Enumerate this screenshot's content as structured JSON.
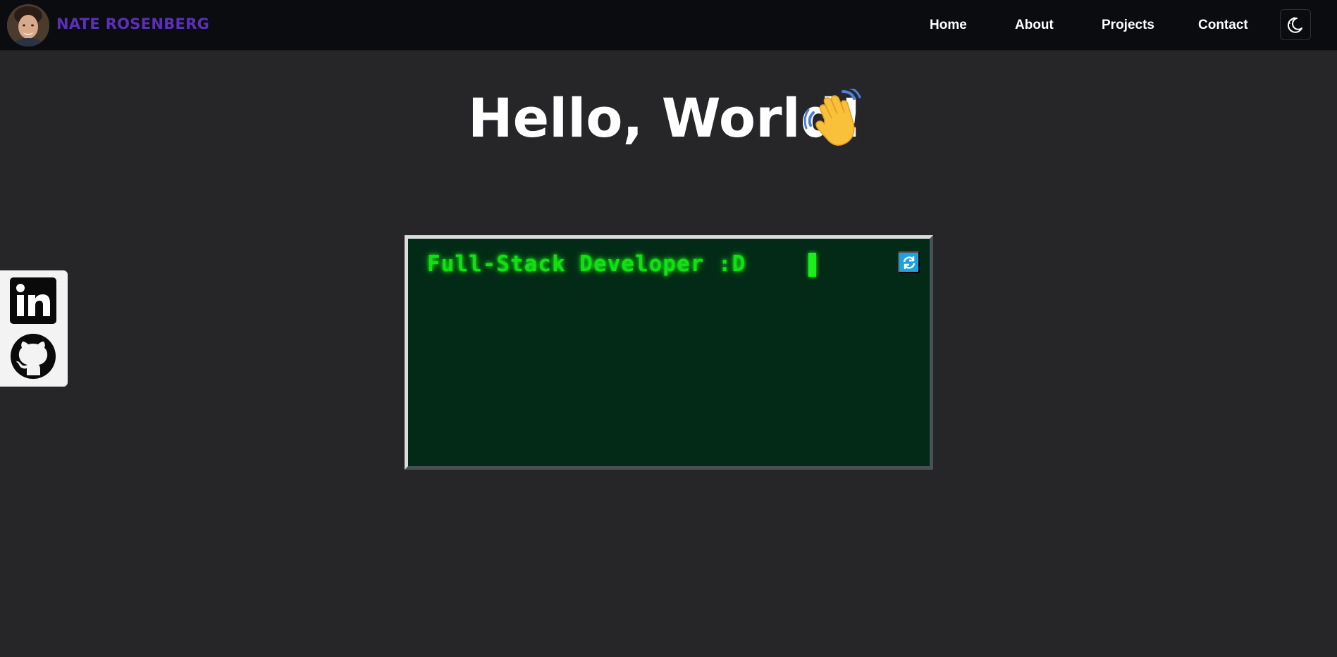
{
  "header": {
    "brand": "NATE ROSENBERG",
    "avatar_icon": "profile-photo",
    "nav": [
      {
        "label": "Home"
      },
      {
        "label": "About"
      },
      {
        "label": "Projects"
      },
      {
        "label": "Contact"
      }
    ],
    "theme_toggle_icon": "moon-stars-icon"
  },
  "hero": {
    "title": "Hello, World!",
    "emoji_icon": "waving-hand-icon"
  },
  "social": [
    {
      "icon": "linkedin-icon"
    },
    {
      "icon": "github-icon"
    }
  ],
  "terminal": {
    "text": "Full-Stack Developer :D",
    "refresh_icon": "refresh-icon",
    "text_color": "#12e012",
    "background_color": "#032a16"
  },
  "colors": {
    "page_background": "#262628",
    "navbar_background": "#0b0c0f",
    "brand_color": "#5b2fb8",
    "refresh_button": "#1fa3e0"
  }
}
